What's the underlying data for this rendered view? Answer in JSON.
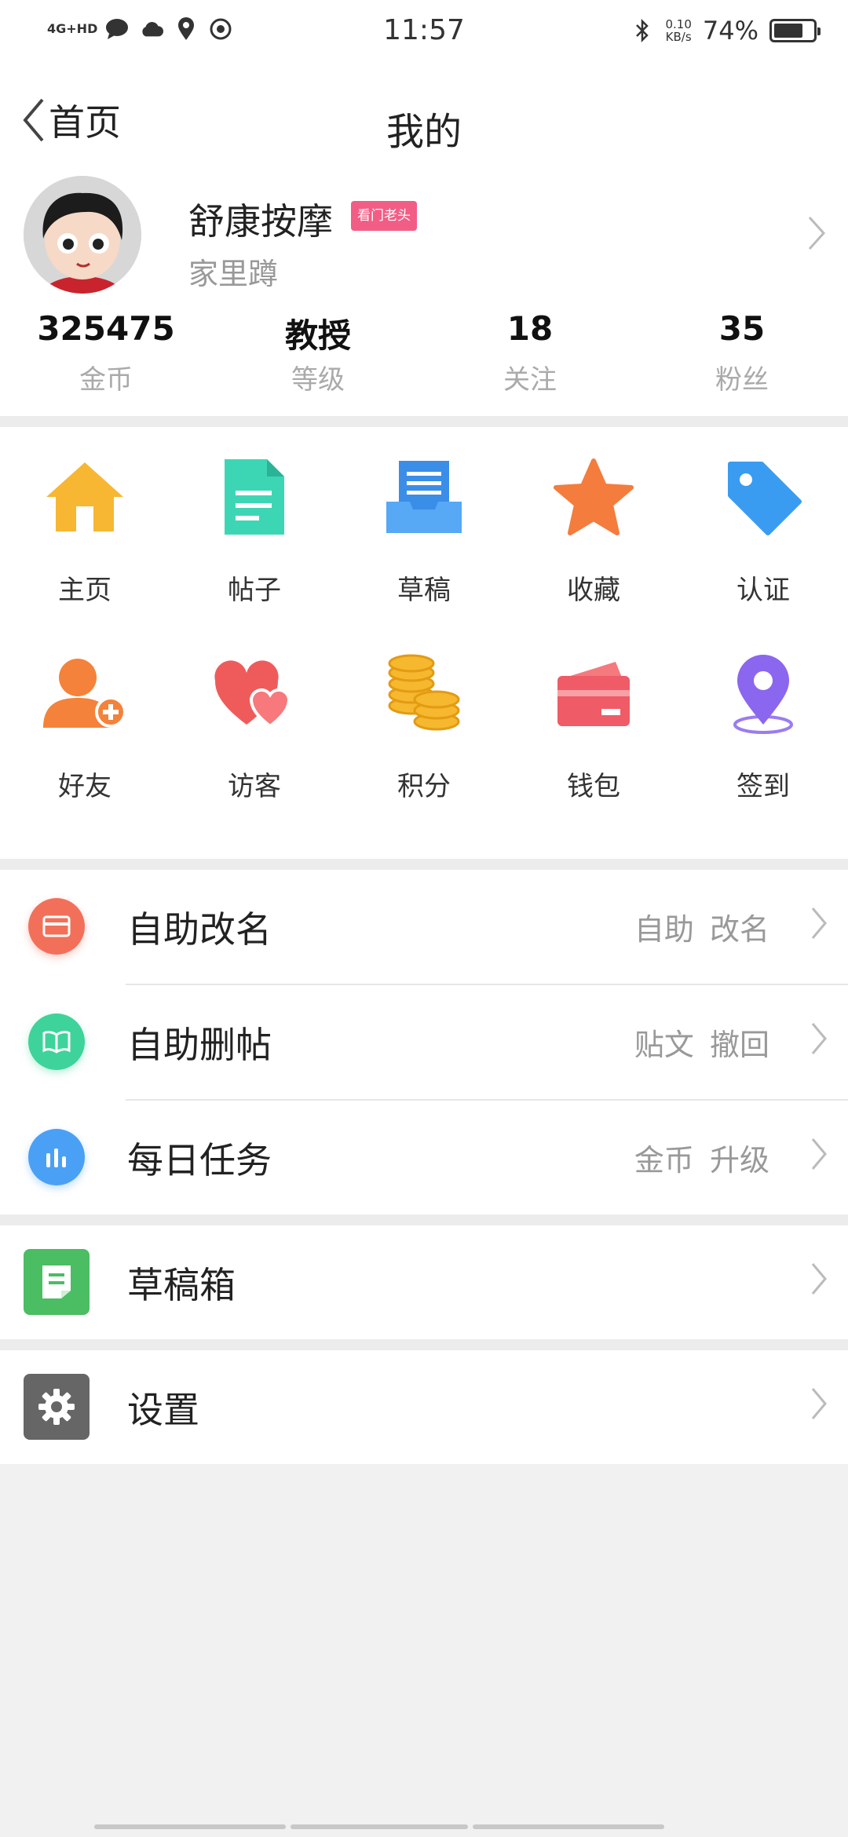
{
  "status_bar": {
    "network": "4G+HD",
    "time": "11:57",
    "speed_value": "0.10",
    "speed_unit": "KB/s",
    "battery": "74%",
    "battery_level": 0.74
  },
  "header": {
    "back_label": "首页",
    "title": "我的"
  },
  "profile": {
    "name": "舒康按摩",
    "badge": "看门老头",
    "subtitle": "家里蹲"
  },
  "stats": [
    {
      "value": "325475",
      "label": "金币"
    },
    {
      "value": "教授",
      "label": "等级"
    },
    {
      "value": "18",
      "label": "关注"
    },
    {
      "value": "35",
      "label": "粉丝"
    }
  ],
  "grid": [
    {
      "label": "主页",
      "icon": "home-icon"
    },
    {
      "label": "帖子",
      "icon": "document-icon"
    },
    {
      "label": "草稿",
      "icon": "draft-tray-icon"
    },
    {
      "label": "收藏",
      "icon": "star-icon"
    },
    {
      "label": "认证",
      "icon": "tag-icon"
    },
    {
      "label": "好友",
      "icon": "add-friend-icon"
    },
    {
      "label": "访客",
      "icon": "hearts-icon"
    },
    {
      "label": "积分",
      "icon": "coins-icon"
    },
    {
      "label": "钱包",
      "icon": "wallet-icon"
    },
    {
      "label": "签到",
      "icon": "location-pin-icon"
    }
  ],
  "list1": [
    {
      "title": "自助改名",
      "right": "自助 改名",
      "icon": "card-icon",
      "color": "#f2705a"
    },
    {
      "title": "自助删帖",
      "right": "贴文 撤回",
      "icon": "book-icon",
      "color": "#3ed39a"
    },
    {
      "title": "每日任务",
      "right": "金币 升级",
      "icon": "bar-chart-icon",
      "color": "#4aa0f5"
    }
  ],
  "drafts": {
    "title": "草稿箱",
    "icon": "draft-box-icon",
    "color": "#4bbd63"
  },
  "settings": {
    "title": "设置",
    "icon": "gear-icon",
    "color": "#666666"
  }
}
